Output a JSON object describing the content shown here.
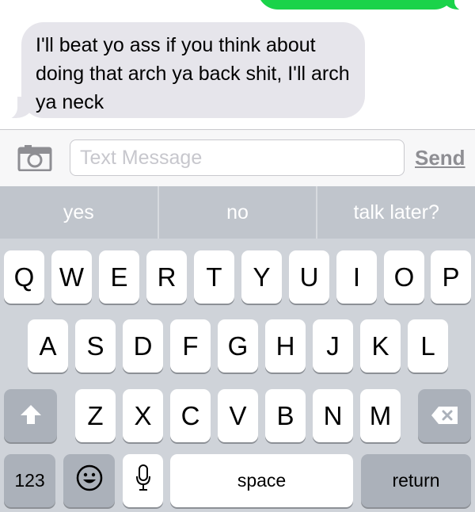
{
  "conversation": {
    "received_message": "I'll beat yo ass if you think about doing that arch ya back shit, I'll arch ya neck",
    "sent_bubble_color": "#1ad34a",
    "received_bubble_color": "#e6e5eb"
  },
  "input_bar": {
    "camera_icon": "camera-icon",
    "placeholder": "Text Message",
    "value": "",
    "send_label": "Send"
  },
  "keyboard": {
    "predictions": [
      "yes",
      "no",
      "talk later?"
    ],
    "row1": [
      "Q",
      "W",
      "E",
      "R",
      "T",
      "Y",
      "U",
      "I",
      "O",
      "P"
    ],
    "row2": [
      "A",
      "S",
      "D",
      "F",
      "G",
      "H",
      "J",
      "K",
      "L"
    ],
    "row3": [
      "Z",
      "X",
      "C",
      "V",
      "B",
      "N",
      "M"
    ],
    "shift_icon": "shift-arrow-icon",
    "delete_icon": "delete-backspace-icon",
    "numbers_label": "123",
    "emoji_icon": "emoji-smiley-icon",
    "mic_icon": "microphone-icon",
    "space_label": "space",
    "return_label": "return"
  }
}
